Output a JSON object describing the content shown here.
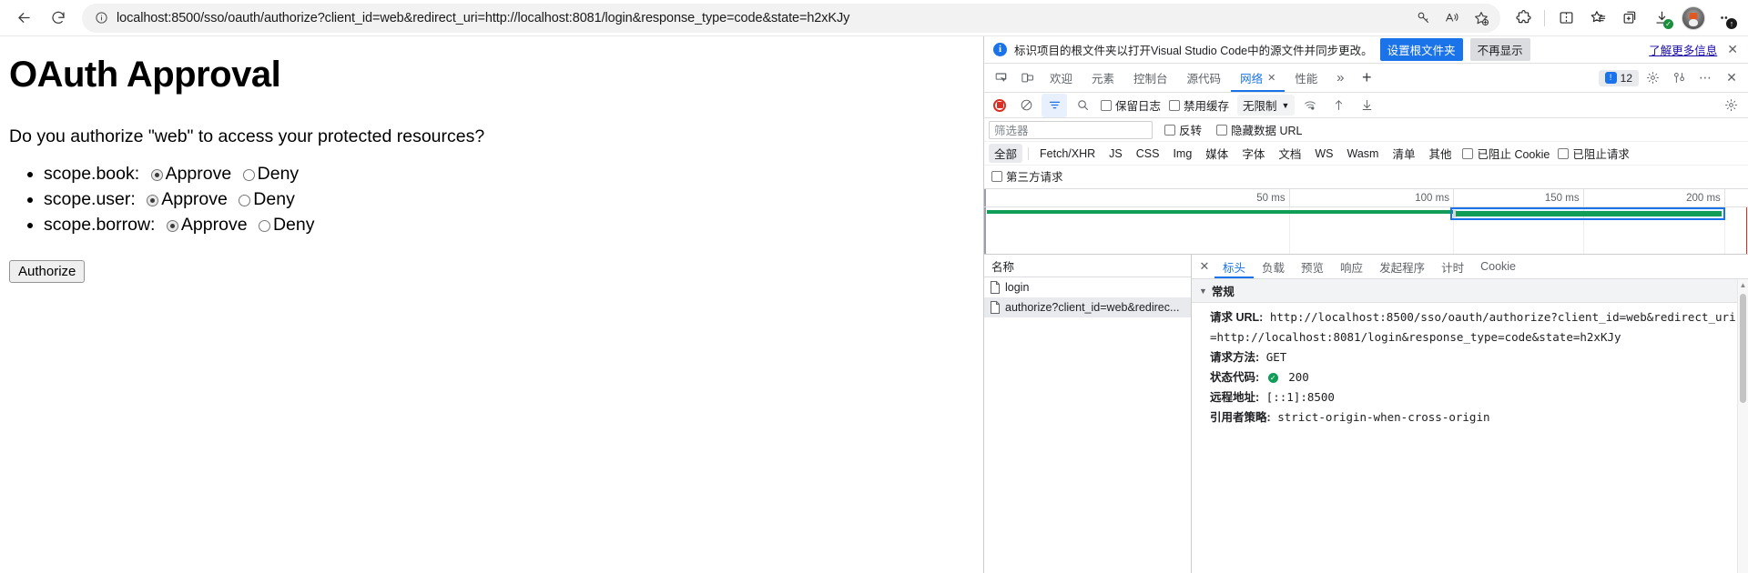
{
  "browser": {
    "back_tooltip": "Back",
    "refresh_tooltip": "Refresh",
    "url": "localhost:8500/sso/oauth/authorize?client_id=web&redirect_uri=http://localhost:8081/login&response_type=code&state=h2xKJy",
    "icons": {
      "info": "info-icon",
      "key": "key-icon",
      "read_aloud": "read-aloud-icon",
      "add_favorite": "add-favorite-icon",
      "extensions": "extensions-icon",
      "split_screen": "split-screen-icon",
      "favorites": "favorites-icon",
      "collections": "collections-icon",
      "downloads": "downloads-icon",
      "profile": "profile-avatar",
      "settings_more": "settings-and-more-icon"
    }
  },
  "page": {
    "title": "OAuth Approval",
    "question": "Do you authorize \"web\" to access your protected resources?",
    "scopes": [
      {
        "name": "scope.book:",
        "approve_label": "Approve",
        "deny_label": "Deny",
        "selected": "approve"
      },
      {
        "name": "scope.user:",
        "approve_label": "Approve",
        "deny_label": "Deny",
        "selected": "approve"
      },
      {
        "name": "scope.borrow:",
        "approve_label": "Approve",
        "deny_label": "Deny",
        "selected": "approve"
      }
    ],
    "authorize_button": "Authorize"
  },
  "devtools": {
    "notice": {
      "text": "标识项目的根文件夹以打开Visual Studio Code中的源文件并同步更改。",
      "primary_button": "设置根文件夹",
      "secondary_button": "不再显示",
      "link": "了解更多信息",
      "close": "✕"
    },
    "tabs": [
      {
        "label": "欢迎",
        "active": false,
        "closable": false
      },
      {
        "label": "元素",
        "active": false,
        "closable": false
      },
      {
        "label": "控制台",
        "active": false,
        "closable": false
      },
      {
        "label": "源代码",
        "active": false,
        "closable": false
      },
      {
        "label": "网络",
        "active": true,
        "closable": true
      },
      {
        "label": "性能",
        "active": false,
        "closable": false
      }
    ],
    "tab_overflow": "»",
    "tab_add": "+",
    "issues_count": "12",
    "toolbar": {
      "record_label": "record",
      "clear_label": "clear",
      "filter_label": "filter",
      "search_label": "search",
      "preserve_log": "保留日志",
      "disable_cache": "禁用缓存",
      "throttling": "无限制",
      "throttle_caret": "▼",
      "import_label": "import-har",
      "export_label": "export-har",
      "settings_label": "settings"
    },
    "filter_row": {
      "placeholder": "筛选器",
      "invert": "反转",
      "hide_data_urls": "隐藏数据 URL"
    },
    "types": [
      "全部",
      "Fetch/XHR",
      "JS",
      "CSS",
      "Img",
      "媒体",
      "字体",
      "文档",
      "WS",
      "Wasm",
      "清单",
      "其他"
    ],
    "active_type": "全部",
    "blocked_cookies": "已阻止 Cookie",
    "blocked_requests": "已阻止请求",
    "third_party": "第三方请求",
    "timeline": {
      "ticks": [
        "50 ms",
        "100 ms",
        "150 ms",
        "200 ms"
      ]
    },
    "requests": {
      "column_name": "名称",
      "rows": [
        {
          "name": "login",
          "selected": false
        },
        {
          "name": "authorize?client_id=web&redirec...",
          "selected": true
        }
      ]
    },
    "detail": {
      "close": "✕",
      "tabs": [
        "标头",
        "负载",
        "预览",
        "响应",
        "发起程序",
        "计时",
        "Cookie"
      ],
      "active_tab": "标头",
      "section_title": "常规",
      "fields": [
        {
          "key": "请求 URL:",
          "value": "http://localhost:8500/sso/oauth/authorize?client_id=web&redirect_uri=http://localhost:8081/login&response_type=code&state=h2xKJy",
          "status": false
        },
        {
          "key": "请求方法:",
          "value": "GET",
          "status": false
        },
        {
          "key": "状态代码:",
          "value": "200",
          "status": true
        },
        {
          "key": "远程地址:",
          "value": "[::1]:8500",
          "status": false
        },
        {
          "key": "引用者策略:",
          "value": "strict-origin-when-cross-origin",
          "status": false
        }
      ]
    }
  },
  "colors": {
    "accent_blue": "#1a73e8",
    "record_red": "#d93025",
    "waterfall_green": "#0f9d58",
    "status_ok_green": "#0f9d58"
  }
}
